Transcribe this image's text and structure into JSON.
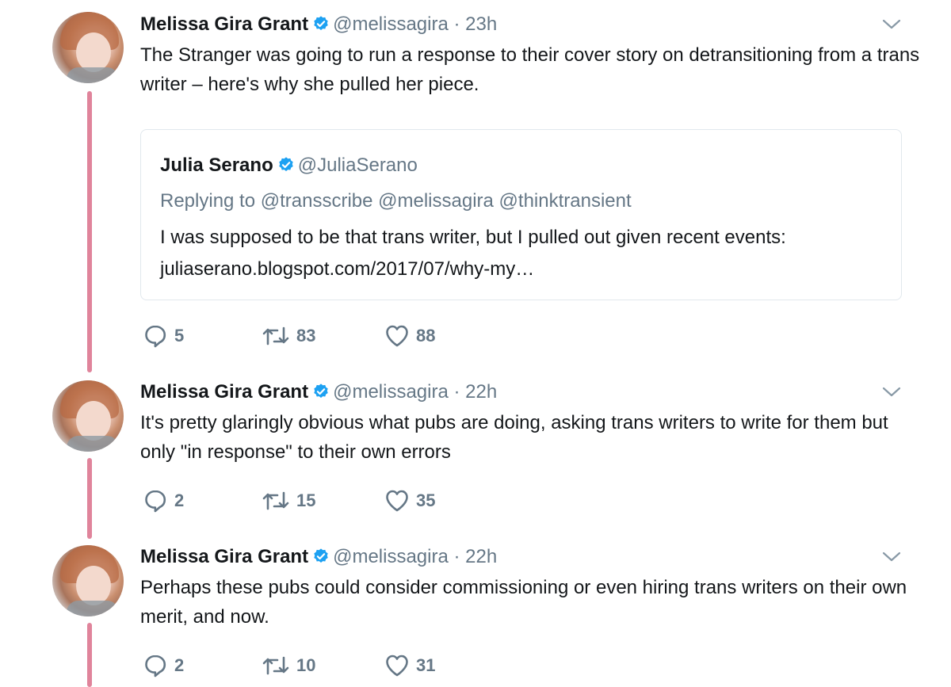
{
  "tweets": [
    {
      "name": "Melissa Gira Grant",
      "handle": "@melissagira",
      "separator": "·",
      "time": "23h",
      "text": "The Stranger was going to run a response to their cover story on detransitioning from a trans writer – here's why she pulled her piece.",
      "quote": {
        "name": "Julia Serano",
        "handle": "@JuliaSerano",
        "replying": "Replying to @transscribe @melissagira @thinktransient",
        "text_line1": "I was supposed to be that trans writer, but I pulled out given recent events:",
        "text_line2": "juliaserano.blogspot.com/2017/07/why-my…"
      },
      "replies": "5",
      "retweets": "83",
      "likes": "88"
    },
    {
      "name": "Melissa Gira Grant",
      "handle": "@melissagira",
      "separator": "·",
      "time": "22h",
      "text": "It's pretty glaringly obvious what pubs are doing, asking trans writers to write for them but only \"in response\" to their own errors",
      "replies": "2",
      "retweets": "15",
      "likes": "35"
    },
    {
      "name": "Melissa Gira Grant",
      "handle": "@melissagira",
      "separator": "·",
      "time": "22h",
      "text": "Perhaps these pubs could consider commissioning or even hiring trans writers on their own merit, and now.",
      "replies": "2",
      "retweets": "10",
      "likes": "31"
    }
  ],
  "icons": {
    "verified": "verified-badge-icon",
    "caret": "chevron-down-icon",
    "reply": "reply-icon",
    "retweet": "retweet-icon",
    "like": "heart-icon"
  },
  "colors": {
    "thread_line": "#e0849b",
    "verified": "#1da1f2",
    "secondary_text": "#657786",
    "primary_text": "#14171a"
  }
}
